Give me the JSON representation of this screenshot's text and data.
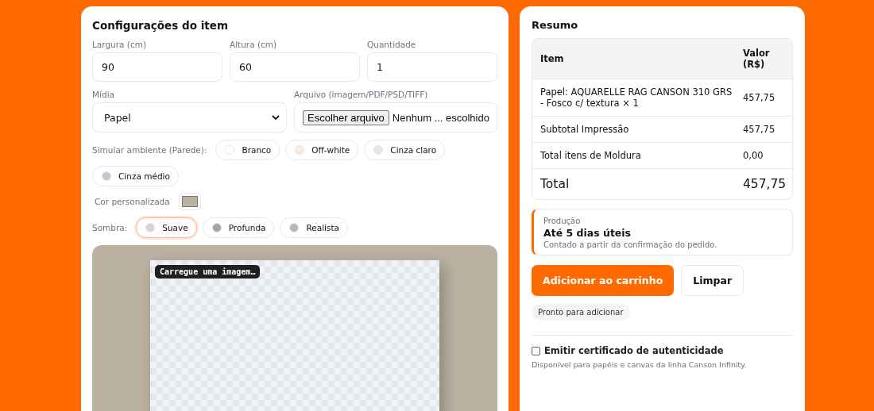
{
  "settings": {
    "title": "Configurações do item",
    "fields": [
      {
        "label": "Largura (cm)",
        "value": "90"
      },
      {
        "label": "Altura (cm)",
        "value": "60"
      },
      {
        "label": "Quantidade",
        "value": "1"
      }
    ],
    "media": {
      "label": "Mídia",
      "value": "Papel"
    },
    "file": {
      "label": "Arquivo (imagem/PDF/PSD/TIFF)",
      "button": "Escolher arquivo",
      "status": "Nenhum ... escolhido"
    },
    "wall": {
      "label": "Simular ambiente (Parede):",
      "options": [
        {
          "label": "Branco",
          "color": "#ffffff",
          "selected": false
        },
        {
          "label": "Off-white",
          "color": "#f6ebe0",
          "selected": false
        },
        {
          "label": "Cinza claro",
          "color": "#e2e6ec",
          "selected": false
        },
        {
          "label": "Cinza médio",
          "color": "#c3c8d1",
          "selected": false
        }
      ]
    },
    "custom_color": {
      "label": "Cor personalizada",
      "color": "#bbb2a2"
    },
    "shadow": {
      "label": "Sombra:",
      "options": [
        {
          "label": "Suave",
          "color": "#d4d4d4",
          "selected": true
        },
        {
          "label": "Profunda",
          "color": "#a3a3a3",
          "selected": false
        },
        {
          "label": "Realista",
          "color": "#b8b8b8",
          "selected": false
        }
      ]
    },
    "preview": {
      "caption": "Carregue uma imagem…"
    }
  },
  "summary": {
    "title": "Resumo",
    "table": {
      "columns": [
        "Item",
        "Valor (R$)"
      ],
      "rows": [
        [
          "Papel: AQUARELLE RAG CANSON 310 GRS - Fosco c/ textura × 1",
          "457,75"
        ],
        [
          "Subtotal Impressão",
          "457,75"
        ],
        [
          "Total itens de Moldura",
          "0,00"
        ]
      ],
      "total": {
        "label": "Total",
        "value": "457,75"
      }
    },
    "production": {
      "label": "Produção",
      "headline": "Até 5 dias úteis",
      "note": "Contado a partir da confirmação do pedido."
    },
    "buttons": [
      {
        "label": "Adicionar ao carrinho",
        "kind": "primary"
      },
      {
        "label": "Limpar",
        "kind": "secondary"
      }
    ],
    "status": "Pronto para adicionar",
    "certificate": {
      "label": "Emitir certificado de autenticidade",
      "checked": false,
      "note": "Disponível para papéis e canvas da linha Canson Infinity."
    }
  }
}
